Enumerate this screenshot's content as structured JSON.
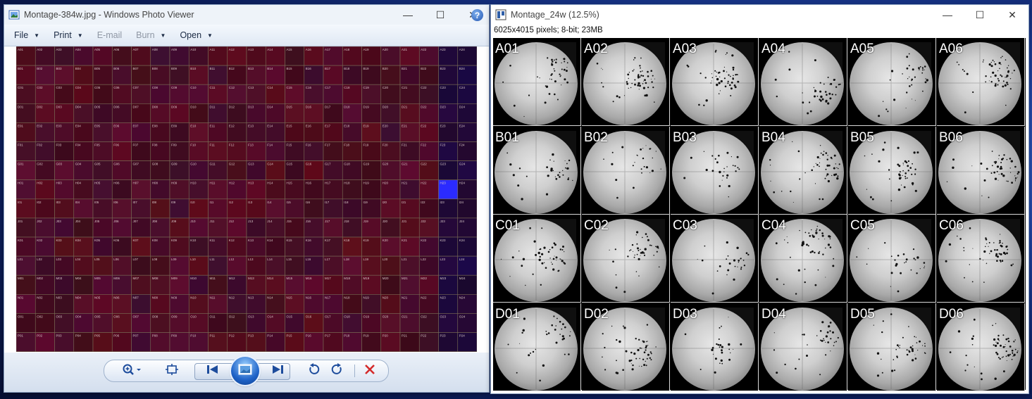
{
  "photo_viewer": {
    "title": "Montage-384w.jpg - Windows Photo Viewer",
    "menu": [
      {
        "label": "File",
        "has_arrow": true,
        "enabled": true
      },
      {
        "label": "Print",
        "has_arrow": true,
        "enabled": true
      },
      {
        "label": "E-mail",
        "has_arrow": false,
        "enabled": false
      },
      {
        "label": "Burn",
        "has_arrow": true,
        "enabled": false
      },
      {
        "label": "Open",
        "has_arrow": true,
        "enabled": true
      }
    ],
    "help_label": "?",
    "grid_rows": [
      "A",
      "B",
      "C",
      "D",
      "E",
      "F",
      "G",
      "H",
      "I",
      "J",
      "K",
      "L",
      "M",
      "N",
      "O",
      "P"
    ],
    "grid_cols": 24,
    "highlight_wells": [
      "H23"
    ]
  },
  "imagej": {
    "title": "Montage_24w (12.5%)",
    "info": "6025x4015 pixels; 8-bit; 23MB",
    "wells": [
      [
        "A01",
        "A02",
        "A03",
        "A04",
        "A05",
        "A06"
      ],
      [
        "B01",
        "B02",
        "B03",
        "B04",
        "B05",
        "B06"
      ],
      [
        "C01",
        "C02",
        "C03",
        "C04",
        "C05",
        "C06"
      ],
      [
        "D01",
        "D02",
        "D03",
        "D04",
        "D05",
        "D06"
      ]
    ]
  },
  "window_controls": {
    "minimize": "—",
    "maximize": "☐",
    "close": "✕"
  },
  "colors": {
    "accent": "#2356b2",
    "well_bg": "#23060e",
    "highlight": "#2b2bff"
  }
}
